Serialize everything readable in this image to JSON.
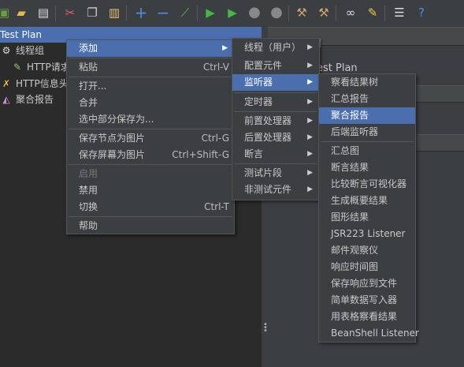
{
  "colors": {
    "bg": "#3c3f41",
    "tree_bg": "#2b2b2b",
    "highlight": "#4b6eaf"
  },
  "toolbar": {
    "icons": [
      "test-plan-icon",
      "open-icon",
      "save-icon",
      "cut-icon",
      "copy-icon",
      "paste-icon",
      "expand-icon",
      "collapse-icon",
      "toggle-icon",
      "start-icon",
      "start-no-pause-icon",
      "stop-icon",
      "shutdown-icon",
      "clear-icon",
      "clear-all-icon",
      "search-icon",
      "reset-search-icon",
      "function-helper-icon",
      "help-icon"
    ]
  },
  "tree": {
    "root": "Test Plan",
    "items": [
      "线程组",
      "HTTP请求",
      "HTTP信息头管理器",
      "聚合报告"
    ]
  },
  "right_panel": {
    "title_fragment": "est Plan",
    "letter": "l"
  },
  "context_menu": {
    "items": [
      {
        "label": "添加",
        "submenu": true
      },
      {
        "label": "粘贴",
        "shortcut": "Ctrl-V"
      },
      {
        "label": "打开..."
      },
      {
        "label": "合并"
      },
      {
        "label": "选中部分保存为..."
      },
      {
        "label": "保存节点为图片",
        "shortcut": "Ctrl-G"
      },
      {
        "label": "保存屏幕为图片",
        "shortcut": "Ctrl+Shift-G"
      },
      {
        "label": "启用",
        "disabled": true
      },
      {
        "label": "禁用"
      },
      {
        "label": "切换",
        "shortcut": "Ctrl-T"
      },
      {
        "label": "帮助"
      }
    ]
  },
  "add_menu": {
    "items": [
      "线程（用户）",
      "配置元件",
      "监听器",
      "定时器",
      "前置处理器",
      "后置处理器",
      "断言",
      "测试片段",
      "非测试元件"
    ]
  },
  "listener_menu": {
    "items": [
      "察看结果树",
      "汇总报告",
      "聚合报告",
      "后端监听器",
      "汇总图",
      "断言结果",
      "比较断言可视化器",
      "生成概要结果",
      "图形结果",
      "JSR223 Listener",
      "邮件观察仪",
      "响应时间图",
      "保存响应到文件",
      "简单数据写入器",
      "用表格察看结果",
      "BeanShell Listener"
    ]
  }
}
